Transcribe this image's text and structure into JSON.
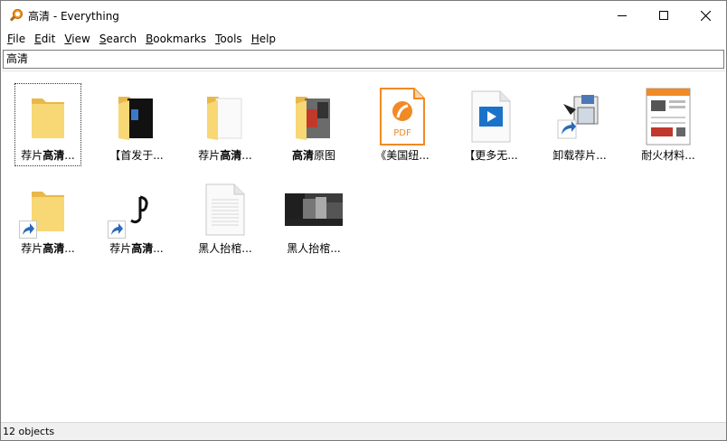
{
  "window": {
    "title": "高清 - Everything",
    "minimize_icon": "minimize-icon",
    "maximize_icon": "maximize-icon",
    "close_icon": "close-icon"
  },
  "menu": [
    {
      "label": "File",
      "key": "F"
    },
    {
      "label": "Edit",
      "key": "E"
    },
    {
      "label": "View",
      "key": "V"
    },
    {
      "label": "Search",
      "key": "S"
    },
    {
      "label": "Bookmarks",
      "key": "B"
    },
    {
      "label": "Tools",
      "key": "T"
    },
    {
      "label": "Help",
      "key": "H"
    }
  ],
  "search": {
    "value": "高清"
  },
  "items": [
    {
      "pre": "荐片",
      "bold": "高清",
      "post": "...",
      "icon": "folder-icon"
    },
    {
      "pre": "【首发于...",
      "bold": "",
      "post": "",
      "icon": "folder-with-images-icon"
    },
    {
      "pre": "荐片",
      "bold": "高清",
      "post": "...",
      "icon": "folder-with-document-icon"
    },
    {
      "pre": "",
      "bold": "高清",
      "post": "原图",
      "icon": "folder-with-photo-icon"
    },
    {
      "pre": "《美国纽...",
      "bold": "",
      "post": "",
      "icon": "pdf-file-icon"
    },
    {
      "pre": "【更多无...",
      "bold": "",
      "post": "",
      "icon": "video-file-icon"
    },
    {
      "pre": "卸载荐片...",
      "bold": "",
      "post": "",
      "icon": "uninstaller-shortcut-icon"
    },
    {
      "pre": "耐火材料...",
      "bold": "",
      "post": "",
      "icon": "document-thumbnail-icon"
    },
    {
      "pre": "荐片",
      "bold": "高清",
      "post": "...",
      "icon": "folder-shortcut-icon"
    },
    {
      "pre": "荐片",
      "bold": "高清",
      "post": "...",
      "icon": "app-shortcut-icon"
    },
    {
      "pre": "黑人抬棺...",
      "bold": "",
      "post": "",
      "icon": "blank-file-icon"
    },
    {
      "pre": "黑人抬棺...",
      "bold": "",
      "post": "",
      "icon": "image-thumbnail-icon"
    }
  ],
  "status": {
    "text": "12 objects"
  },
  "colors": {
    "folder": "#f8d775",
    "folder_dark": "#e8b94a",
    "pdf": "#f08a24",
    "video": "#1a73c8",
    "shortcut_arrow": "#2a6ab8"
  }
}
